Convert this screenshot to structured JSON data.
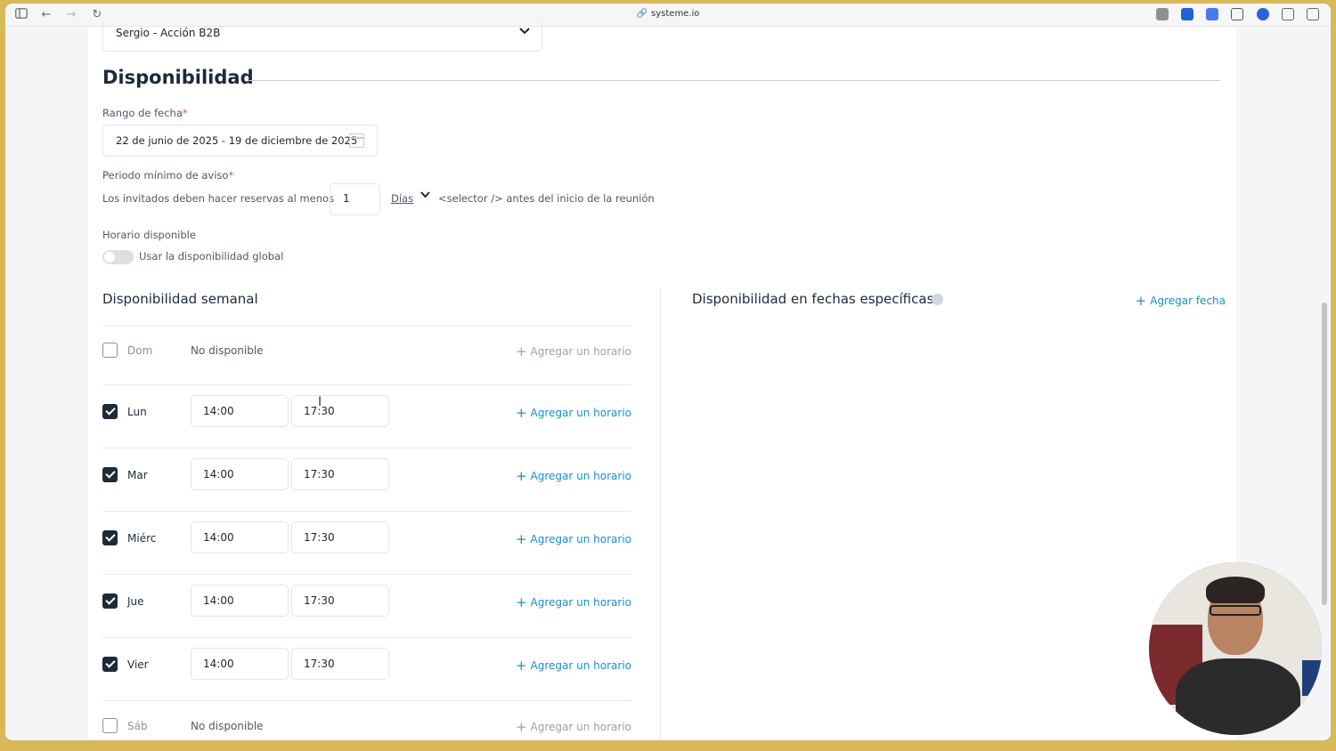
{
  "browser": {
    "url": "systeme.io"
  },
  "form": {
    "calendar_select_value": "Sergio - Acción B2B",
    "section_title": "Disponibilidad",
    "date_range": {
      "label": "Rango de fecha",
      "required_mark": "*",
      "value": "22 de junio de 2025 - 19 de diciembre de 2025"
    },
    "min_notice": {
      "label": "Periodo mínimo de aviso",
      "required_mark": "*",
      "prefix_text": "Los invitados deben hacer reservas al menos",
      "value": "1",
      "unit": "Días",
      "suffix_text": "<selector /> antes del inicio de la reunión"
    },
    "available_schedule": {
      "label": "Horario disponible",
      "toggle_label": "Usar la disponibilidad global",
      "toggle_on": false
    },
    "weekly": {
      "title": "Disponibilidad semanal",
      "add_slot_label": "Agregar un horario",
      "unavailable_label": "No disponible",
      "days": [
        {
          "name": "Dom",
          "enabled": false,
          "start": "",
          "end": ""
        },
        {
          "name": "Lun",
          "enabled": true,
          "start": "14:00",
          "end": "17:30"
        },
        {
          "name": "Mar",
          "enabled": true,
          "start": "14:00",
          "end": "17:30"
        },
        {
          "name": "Miérc",
          "enabled": true,
          "start": "14:00",
          "end": "17:30"
        },
        {
          "name": "Jue",
          "enabled": true,
          "start": "14:00",
          "end": "17:30"
        },
        {
          "name": "Vier",
          "enabled": true,
          "start": "14:00",
          "end": "17:30"
        },
        {
          "name": "Sáb",
          "enabled": false,
          "start": "",
          "end": ""
        }
      ]
    },
    "specific_dates": {
      "title": "Disponibilidad en fechas específicas",
      "add_label": "Agregar fecha"
    }
  },
  "colors": {
    "accent": "#1a8fc9",
    "checkbox_checked": "#1d2a3a",
    "required": "#e24b4b"
  },
  "icons": [
    "sidebar-icon",
    "back-icon",
    "forward-icon",
    "reload-icon",
    "link-icon",
    "chevron-down-icon",
    "calendar-icon",
    "plus-icon",
    "info-icon"
  ]
}
